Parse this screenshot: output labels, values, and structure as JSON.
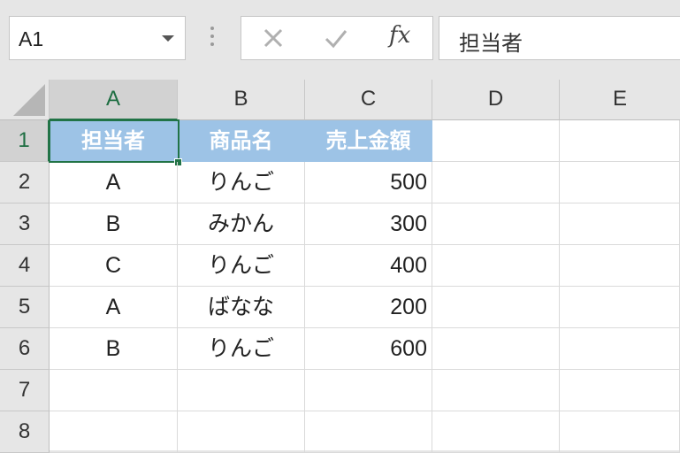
{
  "name_box": {
    "value": "A1"
  },
  "formula_bar": {
    "fx_label": "fx",
    "content": "担当者"
  },
  "columns": [
    "A",
    "B",
    "C",
    "D",
    "E"
  ],
  "rows": [
    "1",
    "2",
    "3",
    "4",
    "5",
    "6",
    "7",
    "8"
  ],
  "header_row": [
    "担当者",
    "商品名",
    "売上金額"
  ],
  "table": [
    [
      "A",
      "りんご",
      "500"
    ],
    [
      "B",
      "みかん",
      "300"
    ],
    [
      "C",
      "りんご",
      "400"
    ],
    [
      "A",
      "ばなな",
      "200"
    ],
    [
      "B",
      "りんご",
      "600"
    ]
  ],
  "colors": {
    "header_fill": "#9dc3e6",
    "selection": "#217346"
  },
  "icons": {
    "cancel": "close-icon",
    "enter": "checkmark-icon"
  }
}
